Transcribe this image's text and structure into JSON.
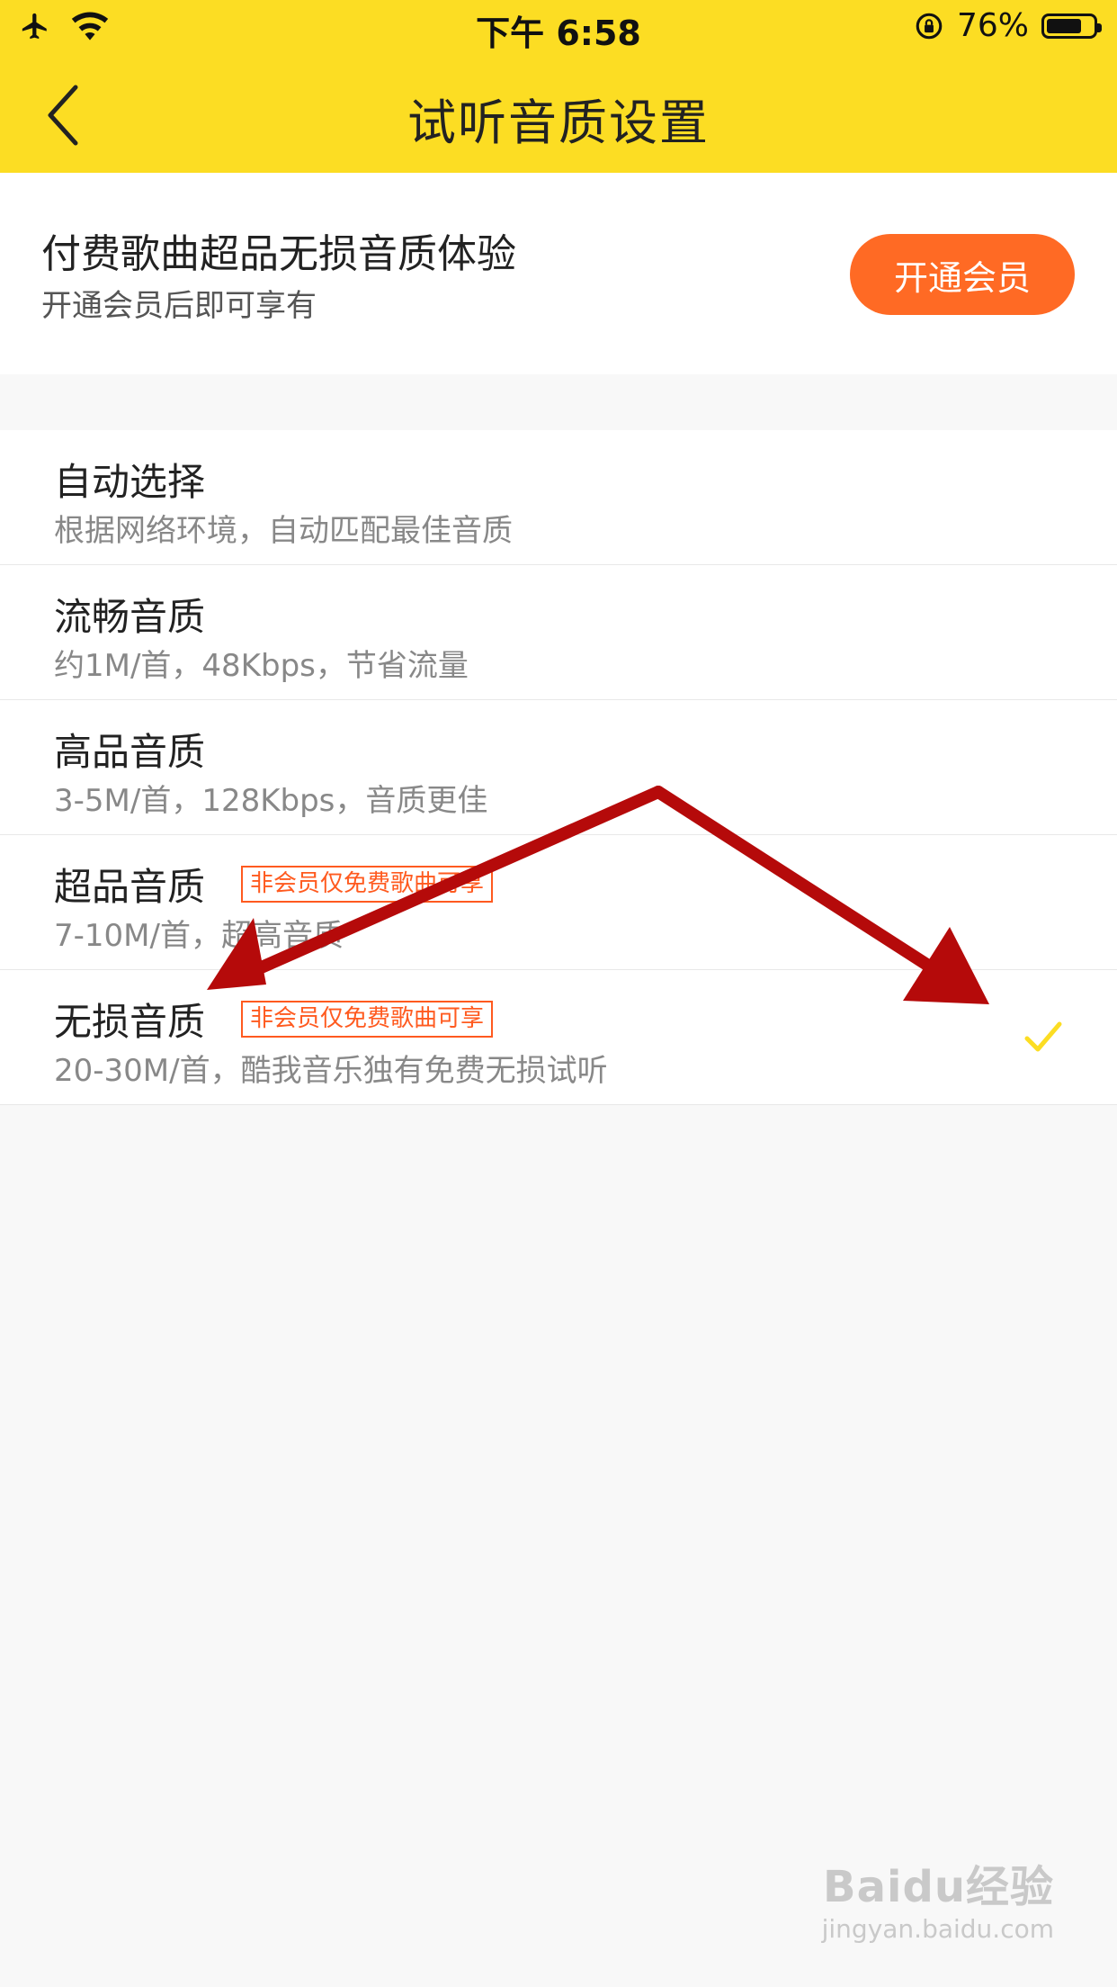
{
  "status_bar": {
    "time": "下午 6:58",
    "battery": "76%",
    "battery_level": 0.76
  },
  "header": {
    "title": "试听音质设置"
  },
  "promo": {
    "title": "付费歌曲超品无损音质体验",
    "subtitle": "开通会员后即可享有",
    "button_label": "开通会员"
  },
  "quality_options": [
    {
      "title": "自动选择",
      "desc": "根据网络环境，自动匹配最佳音质"
    },
    {
      "title": "流畅音质",
      "desc": "约1M/首，48Kbps，节省流量"
    },
    {
      "title": "高品音质",
      "desc": "3-5M/首，128Kbps，音质更佳"
    },
    {
      "title": "超品音质",
      "desc": "7-10M/首，超高音质",
      "badge": "非会员仅免费歌曲可享"
    },
    {
      "title": "无损音质",
      "desc": "20-30M/首，酷我音乐独有免费无损试听",
      "badge": "非会员仅免费歌曲可享",
      "selected": true
    }
  ],
  "watermark": {
    "logo": "Baidu经验",
    "url": "jingyan.baidu.com"
  },
  "colors": {
    "header": "#fcdd23",
    "accent": "#ff6a24",
    "badge": "#ff5a1f",
    "check": "#fcdd23",
    "arrow": "#b50a0a"
  }
}
